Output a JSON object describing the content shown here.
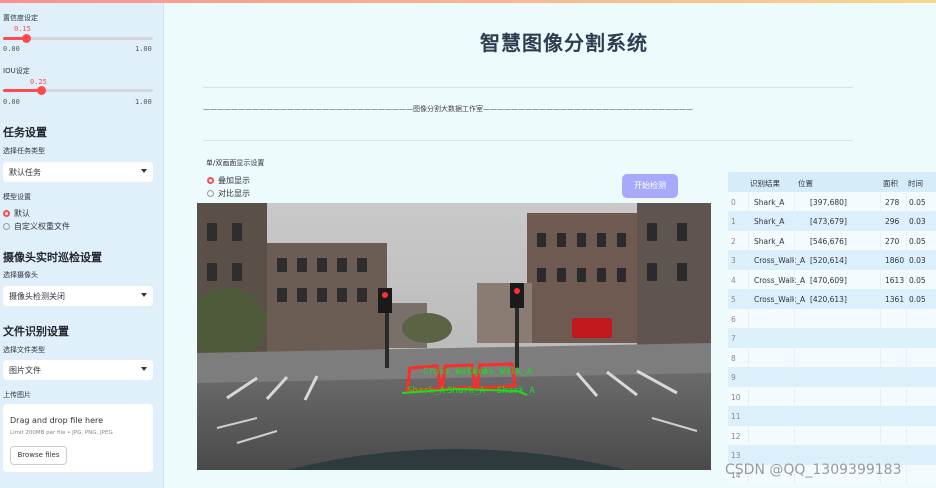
{
  "sidebar": {
    "confidence_label": "置信度设定",
    "confidence_value": "0.15",
    "confidence_min": "0.00",
    "confidence_max": "1.00",
    "confidence_fraction": 0.15,
    "iou_label": "IOU设定",
    "iou_value": "0.25",
    "iou_min": "0.00",
    "iou_max": "1.00",
    "iou_fraction": 0.25,
    "task_heading": "任务设置",
    "task_type_label": "选择任务类型",
    "task_type_value": "默认任务",
    "model_label": "模型设置",
    "model_options": [
      "默认",
      "自定义权重文件"
    ],
    "camera_heading": "摄像头实时巡检设置",
    "camera_label": "选择摄像头",
    "camera_value": "摄像头检测关闭",
    "file_heading": "文件识别设置",
    "file_type_label": "选择文件类型",
    "file_type_value": "图片文件",
    "upload_label": "上传图片",
    "drop_text": "Drag and drop file here",
    "drop_limit": "Limit 200MB per file • JPG, PNG, JPEG",
    "browse_label": "Browse files"
  },
  "main": {
    "title": "智慧图像分割系统",
    "divider_text": "——————————————————————————————图像分割大数据工作室——————————————————————————————",
    "display_label": "单/双画面显示设置",
    "display_options": [
      "叠加显示",
      "对比显示"
    ],
    "start_button": "开始检测",
    "detection_overlay": [
      "Cross_Walk_A",
      "Shark_A"
    ]
  },
  "table": {
    "headers": [
      "识别结果",
      "位置",
      "面积",
      "时间"
    ],
    "rows": [
      {
        "idx": "0",
        "name": "Shark_A",
        "pos": "[397,680]",
        "area": "278",
        "time": "0.05"
      },
      {
        "idx": "1",
        "name": "Shark_A",
        "pos": "[473,679]",
        "area": "296",
        "time": "0.03"
      },
      {
        "idx": "2",
        "name": "Shark_A",
        "pos": "[546,676]",
        "area": "270",
        "time": "0.05"
      },
      {
        "idx": "3",
        "name": "Cross_Walk_A",
        "pos": "[520,614]",
        "area": "1860",
        "time": "0.03"
      },
      {
        "idx": "4",
        "name": "Cross_Walk_A",
        "pos": "[470,609]",
        "area": "1613",
        "time": "0.05"
      },
      {
        "idx": "5",
        "name": "Cross_Walk_A",
        "pos": "[420,613]",
        "area": "1361",
        "time": "0.05"
      },
      {
        "idx": "6",
        "name": "",
        "pos": "",
        "area": "",
        "time": ""
      },
      {
        "idx": "7",
        "name": "",
        "pos": "",
        "area": "",
        "time": ""
      },
      {
        "idx": "8",
        "name": "",
        "pos": "",
        "area": "",
        "time": ""
      },
      {
        "idx": "9",
        "name": "",
        "pos": "",
        "area": "",
        "time": ""
      },
      {
        "idx": "10",
        "name": "",
        "pos": "",
        "area": "",
        "time": ""
      },
      {
        "idx": "11",
        "name": "",
        "pos": "",
        "area": "",
        "time": ""
      },
      {
        "idx": "12",
        "name": "",
        "pos": "",
        "area": "",
        "time": ""
      },
      {
        "idx": "13",
        "name": "",
        "pos": "",
        "area": "",
        "time": ""
      },
      {
        "idx": "14",
        "name": "",
        "pos": "",
        "area": "",
        "time": ""
      }
    ]
  },
  "watermark": "CSDN @QQ_1309399183",
  "colors": {
    "accent": "#ff4b4b",
    "button": "#a8a9fb",
    "sidebar_bg": "#dff0fb",
    "page_bg": "#eefbfd",
    "overlay_green": "#18e018",
    "overlay_red": "#ff2a2a"
  }
}
